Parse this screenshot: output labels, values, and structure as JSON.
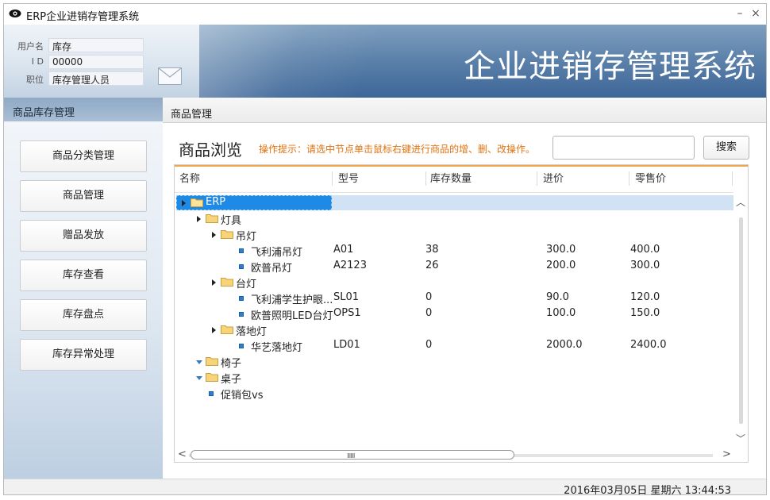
{
  "window": {
    "title": "ERP企业进销存管理系统",
    "minimize_symbol": "–",
    "close_symbol": "×"
  },
  "banner": {
    "title": "企业进销存管理系统",
    "user_fields": [
      {
        "label": "用户名",
        "value": "库存"
      },
      {
        "label": "I D",
        "value": "00000"
      },
      {
        "label": "职位",
        "value": "库存管理人员"
      }
    ],
    "mail_icon": "envelope-icon"
  },
  "sidebar": {
    "header": "商品库存管理",
    "items": [
      {
        "label": "商品分类管理"
      },
      {
        "label": "商品管理"
      },
      {
        "label": "赠品发放"
      },
      {
        "label": "库存查看"
      },
      {
        "label": "库存盘点"
      },
      {
        "label": "库存异常处理"
      }
    ]
  },
  "main": {
    "header": "商品管理",
    "page_title": "商品浏览",
    "tip": "操作提示：请选中节点单击鼠标右键进行商品的增、删、改操作。",
    "search": {
      "value": "",
      "button_label": "搜索"
    },
    "columns": [
      "名称",
      "型号",
      "库存数量",
      "进价",
      "零售价"
    ],
    "rows": [
      {
        "level": 0,
        "type": "folder",
        "toggle": "right",
        "name": "ERP",
        "model": "",
        "qty": "",
        "cost": "",
        "price": "",
        "selected": true
      },
      {
        "level": 1,
        "type": "folder",
        "toggle": "right",
        "name": "灯具",
        "model": "",
        "qty": "",
        "cost": "",
        "price": ""
      },
      {
        "level": 2,
        "type": "folder",
        "toggle": "right",
        "name": "吊灯",
        "model": "",
        "qty": "",
        "cost": "",
        "price": ""
      },
      {
        "level": 3,
        "type": "leaf",
        "name": "飞利浦吊灯",
        "model": "A01",
        "qty": "38",
        "cost": "300.0",
        "price": "400.0"
      },
      {
        "level": 3,
        "type": "leaf",
        "name": "欧普吊灯",
        "model": "A2123",
        "qty": "26",
        "cost": "200.0",
        "price": "300.0"
      },
      {
        "level": 2,
        "type": "folder",
        "toggle": "right",
        "name": "台灯",
        "model": "",
        "qty": "",
        "cost": "",
        "price": ""
      },
      {
        "level": 3,
        "type": "leaf",
        "name": "飞利浦学生护眼...",
        "model": "SL01",
        "qty": "0",
        "cost": "90.0",
        "price": "120.0"
      },
      {
        "level": 3,
        "type": "leaf",
        "name": "欧普照明LED台灯",
        "model": "OPS1",
        "qty": "0",
        "cost": "100.0",
        "price": "150.0"
      },
      {
        "level": 2,
        "type": "folder",
        "toggle": "right",
        "name": "落地灯",
        "model": "",
        "qty": "",
        "cost": "",
        "price": ""
      },
      {
        "level": 3,
        "type": "leaf",
        "name": "华艺落地灯",
        "model": "LD01",
        "qty": "0",
        "cost": "2000.0",
        "price": "2400.0"
      },
      {
        "level": 1,
        "type": "folder",
        "toggle": "down",
        "name": "椅子",
        "model": "",
        "qty": "",
        "cost": "",
        "price": ""
      },
      {
        "level": 1,
        "type": "folder",
        "toggle": "down",
        "name": "桌子",
        "model": "",
        "qty": "",
        "cost": "",
        "price": ""
      },
      {
        "level": 1,
        "type": "leaf",
        "name": "促销包vs",
        "model": "",
        "qty": "",
        "cost": "",
        "price": ""
      }
    ],
    "scroll_grip": "IIIIIII"
  },
  "status": {
    "datetime": "2016年03月05日  星期六  13:44:53"
  },
  "colors": {
    "tip": "#e07310",
    "selection": "#1e8ae6",
    "banner": "#3d6698"
  }
}
